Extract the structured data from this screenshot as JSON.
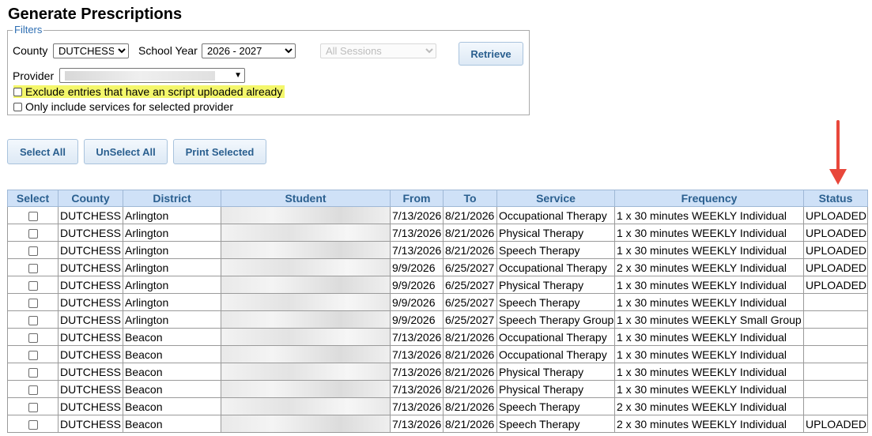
{
  "page": {
    "title": "Generate Prescriptions"
  },
  "filters": {
    "legend": "Filters",
    "county_label": "County",
    "county_value": "DUTCHESS",
    "school_year_label": "School Year",
    "school_year_value": "2026 - 2027",
    "sessions_value": "All Sessions",
    "retrieve_label": "Retrieve",
    "provider_label": "Provider",
    "exclude_label": "Exclude entries that have an script uploaded already",
    "only_include_label": "Only include services for selected provider"
  },
  "actions": {
    "select_all": "Select All",
    "unselect_all": "UnSelect All",
    "print_selected": "Print Selected"
  },
  "table": {
    "headers": [
      "Select",
      "County",
      "District",
      "Student",
      "From",
      "To",
      "Service",
      "Frequency",
      "Status"
    ],
    "rows": [
      {
        "county": "DUTCHESS",
        "district": "Arlington",
        "from": "7/13/2026",
        "to": "8/21/2026",
        "service": "Occupational Therapy",
        "frequency": "1 x 30 minutes WEEKLY Individual",
        "status": "UPLOADED"
      },
      {
        "county": "DUTCHESS",
        "district": "Arlington",
        "from": "7/13/2026",
        "to": "8/21/2026",
        "service": "Physical Therapy",
        "frequency": "1 x 30 minutes WEEKLY Individual",
        "status": "UPLOADED"
      },
      {
        "county": "DUTCHESS",
        "district": "Arlington",
        "from": "7/13/2026",
        "to": "8/21/2026",
        "service": "Speech Therapy",
        "frequency": "1 x 30 minutes WEEKLY Individual",
        "status": "UPLOADED"
      },
      {
        "county": "DUTCHESS",
        "district": "Arlington",
        "from": "9/9/2026",
        "to": "6/25/2027",
        "service": "Occupational Therapy",
        "frequency": "2 x 30 minutes WEEKLY Individual",
        "status": "UPLOADED"
      },
      {
        "county": "DUTCHESS",
        "district": "Arlington",
        "from": "9/9/2026",
        "to": "6/25/2027",
        "service": "Physical Therapy",
        "frequency": "1 x 30 minutes WEEKLY Individual",
        "status": "UPLOADED"
      },
      {
        "county": "DUTCHESS",
        "district": "Arlington",
        "from": "9/9/2026",
        "to": "6/25/2027",
        "service": "Speech Therapy",
        "frequency": "1 x 30 minutes WEEKLY Individual",
        "status": ""
      },
      {
        "county": "DUTCHESS",
        "district": "Arlington",
        "from": "9/9/2026",
        "to": "6/25/2027",
        "service": "Speech Therapy Group",
        "frequency": "1 x 30 minutes WEEKLY Small Group",
        "status": ""
      },
      {
        "county": "DUTCHESS",
        "district": "Beacon",
        "from": "7/13/2026",
        "to": "8/21/2026",
        "service": "Occupational Therapy",
        "frequency": "1 x 30 minutes WEEKLY Individual",
        "status": ""
      },
      {
        "county": "DUTCHESS",
        "district": "Beacon",
        "from": "7/13/2026",
        "to": "8/21/2026",
        "service": "Occupational Therapy",
        "frequency": "1 x 30 minutes WEEKLY Individual",
        "status": ""
      },
      {
        "county": "DUTCHESS",
        "district": "Beacon",
        "from": "7/13/2026",
        "to": "8/21/2026",
        "service": "Physical Therapy",
        "frequency": "1 x 30 minutes WEEKLY Individual",
        "status": ""
      },
      {
        "county": "DUTCHESS",
        "district": "Beacon",
        "from": "7/13/2026",
        "to": "8/21/2026",
        "service": "Physical Therapy",
        "frequency": "1 x 30 minutes WEEKLY Individual",
        "status": ""
      },
      {
        "county": "DUTCHESS",
        "district": "Beacon",
        "from": "7/13/2026",
        "to": "8/21/2026",
        "service": "Speech Therapy",
        "frequency": "2 x 30 minutes WEEKLY Individual",
        "status": ""
      },
      {
        "county": "DUTCHESS",
        "district": "Beacon",
        "from": "7/13/2026",
        "to": "8/21/2026",
        "service": "Speech Therapy",
        "frequency": "2 x 30 minutes WEEKLY Individual",
        "status": "UPLOADED"
      }
    ]
  },
  "colors": {
    "header_bg": "#cfe1f7",
    "header_text": "#2a5f8f",
    "highlight": "#f4f76b",
    "arrow": "#e8473b"
  }
}
